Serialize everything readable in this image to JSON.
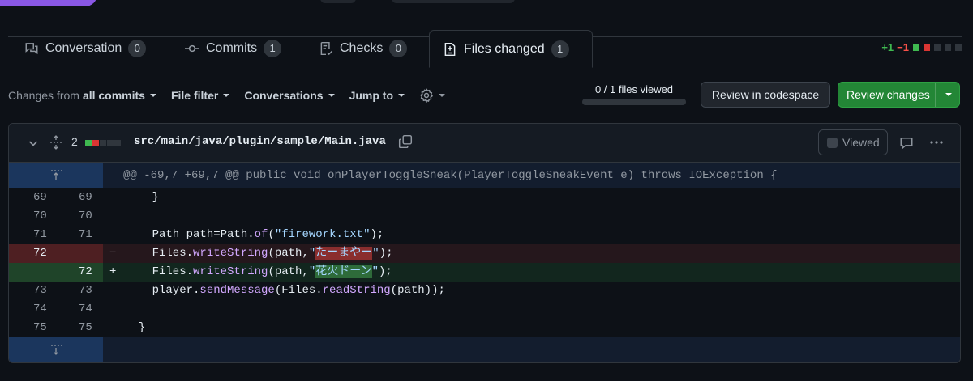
{
  "tabs": [
    {
      "label": "Conversation",
      "count": "0",
      "icon": "comment-discussion-icon"
    },
    {
      "label": "Commits",
      "count": "1",
      "icon": "git-commit-icon"
    },
    {
      "label": "Checks",
      "count": "0",
      "icon": "checklist-icon"
    },
    {
      "label": "Files changed",
      "count": "1",
      "icon": "file-diff-icon"
    }
  ],
  "diffstat": {
    "additions": "+1",
    "deletions": "−1"
  },
  "toolbar": {
    "changes_prefix": "Changes from",
    "changes_value": "all commits",
    "file_filter": "File filter",
    "conversations": "Conversations",
    "jump_to": "Jump to",
    "files_viewed": "0 / 1 files viewed",
    "review_codespace": "Review in codespace",
    "review_changes": "Review changes"
  },
  "file": {
    "changes": "2",
    "path": "src/main/java/plugin/sample/Main.java",
    "viewed_label": "Viewed"
  },
  "diff": {
    "hunk": "@@ -69,7 +69,7 @@ public void onPlayerToggleSneak(PlayerToggleSneakEvent e) throws IOException {",
    "lines": [
      {
        "old": "69",
        "new": "69",
        "type": "ctx",
        "code": "    }"
      },
      {
        "old": "70",
        "new": "70",
        "type": "ctx",
        "code": ""
      },
      {
        "old": "71",
        "new": "71",
        "type": "ctx",
        "code_a": "    Path path=Path.",
        "fn": "of",
        "code_b": "(",
        "str": "\"firework.txt\"",
        "code_c": ");"
      },
      {
        "old": "72",
        "new": "",
        "type": "del",
        "sign": "−",
        "code_a": "    Files.",
        "fn": "writeString",
        "code_b": "(path,",
        "str_a": "\"",
        "hl": "たーまやー",
        "str_b": "\"",
        "code_c": ");"
      },
      {
        "old": "",
        "new": "72",
        "type": "add",
        "sign": "+",
        "code_a": "    Files.",
        "fn": "writeString",
        "code_b": "(path,",
        "str_a": "\"",
        "hl": "花火ドーン",
        "str_b": "\"",
        "code_c": ");"
      },
      {
        "old": "73",
        "new": "73",
        "type": "ctx",
        "code_a": "    player.",
        "fn": "sendMessage",
        "code_b": "(Files.",
        "fn2": "readString",
        "code_c": "(path));"
      },
      {
        "old": "74",
        "new": "74",
        "type": "ctx",
        "code": ""
      },
      {
        "old": "75",
        "new": "75",
        "type": "ctx",
        "code": "  }"
      }
    ]
  },
  "colors": {
    "accent_green": "#238636",
    "addition": "#3fb950",
    "deletion": "#f85149"
  }
}
